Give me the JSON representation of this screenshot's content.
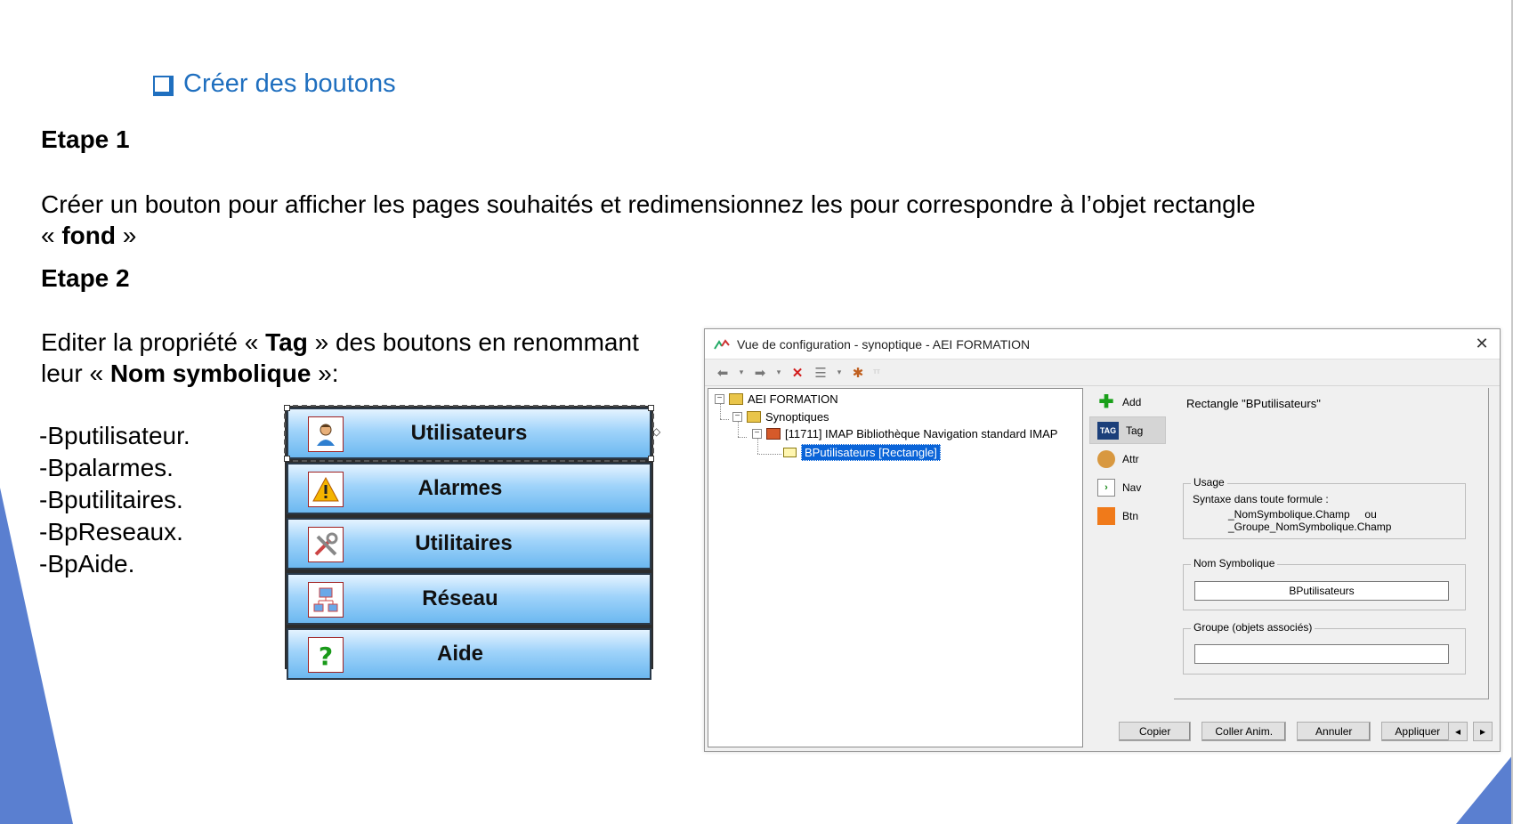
{
  "slide": {
    "heading": "Créer des boutons",
    "step1_title": "Etape 1",
    "step1_line1": "Créer un bouton pour afficher les pages souhaités et redimensionnez les pour correspondre à l’objet rectangle",
    "step1_line2_pre": "« ",
    "step1_line2_bold": "fond",
    "step1_line2_post": " »",
    "step2_title": "Etape 2",
    "step2_l1_pre": "Editer la propriété « ",
    "step2_l1_bold": "Tag",
    "step2_l1_post": " » des boutons en renommant",
    "step2_l2_pre": "leur « ",
    "step2_l2_bold": "Nom symbolique",
    "step2_l2_post": " »:",
    "bullets": [
      "-Bputilisateur.",
      "-Bpalarmes.",
      "-Bputilitaires.",
      "-BpReseaux.",
      "-BpAide."
    ]
  },
  "buttons": [
    {
      "label": "Utilisateurs",
      "icon": "user-icon"
    },
    {
      "label": "Alarmes",
      "icon": "warning-icon"
    },
    {
      "label": "Utilitaires",
      "icon": "tools-icon"
    },
    {
      "label": "Réseau",
      "icon": "network-icon"
    },
    {
      "label": "Aide",
      "icon": "help-icon"
    }
  ],
  "window": {
    "title": "Vue de configuration - synoptique - AEI FORMATION",
    "tree": {
      "root": "AEI FORMATION",
      "synoptiques": "Synoptiques",
      "page": "[11711]  IMAP Bibliothèque Navigation standard IMAP",
      "selected": "BPutilisateurs [Rectangle]"
    },
    "sidebar": [
      {
        "label": "Add",
        "icon": "plus-icon"
      },
      {
        "label": "Tag",
        "icon": "tag-icon"
      },
      {
        "label": "Attr",
        "icon": "palette-icon"
      },
      {
        "label": "Nav",
        "icon": "nav-arrow-icon"
      },
      {
        "label": "Btn",
        "icon": "button-icon"
      }
    ],
    "panel": {
      "object_title": "Rectangle  \"BPutilisateurs\"",
      "usage_legend": "Usage",
      "usage_line1": "Syntaxe dans toute formule :",
      "usage_line2": "_NomSymbolique.Champ     ou",
      "usage_line3": "_Groupe_NomSymbolique.Champ",
      "nom_legend": "Nom Symbolique",
      "nom_value": "BPutilisateurs",
      "groupe_legend": "Groupe (objets associés)",
      "groupe_value": ""
    },
    "bottom_buttons": [
      "Copier",
      "Coller Anim.",
      "Annuler",
      "Appliquer"
    ],
    "nav_prev": "◂",
    "nav_next": "▸"
  },
  "colors": {
    "heading": "#1f6fbf",
    "deco": "#5a7fd0",
    "selection": "#0a64d8"
  }
}
